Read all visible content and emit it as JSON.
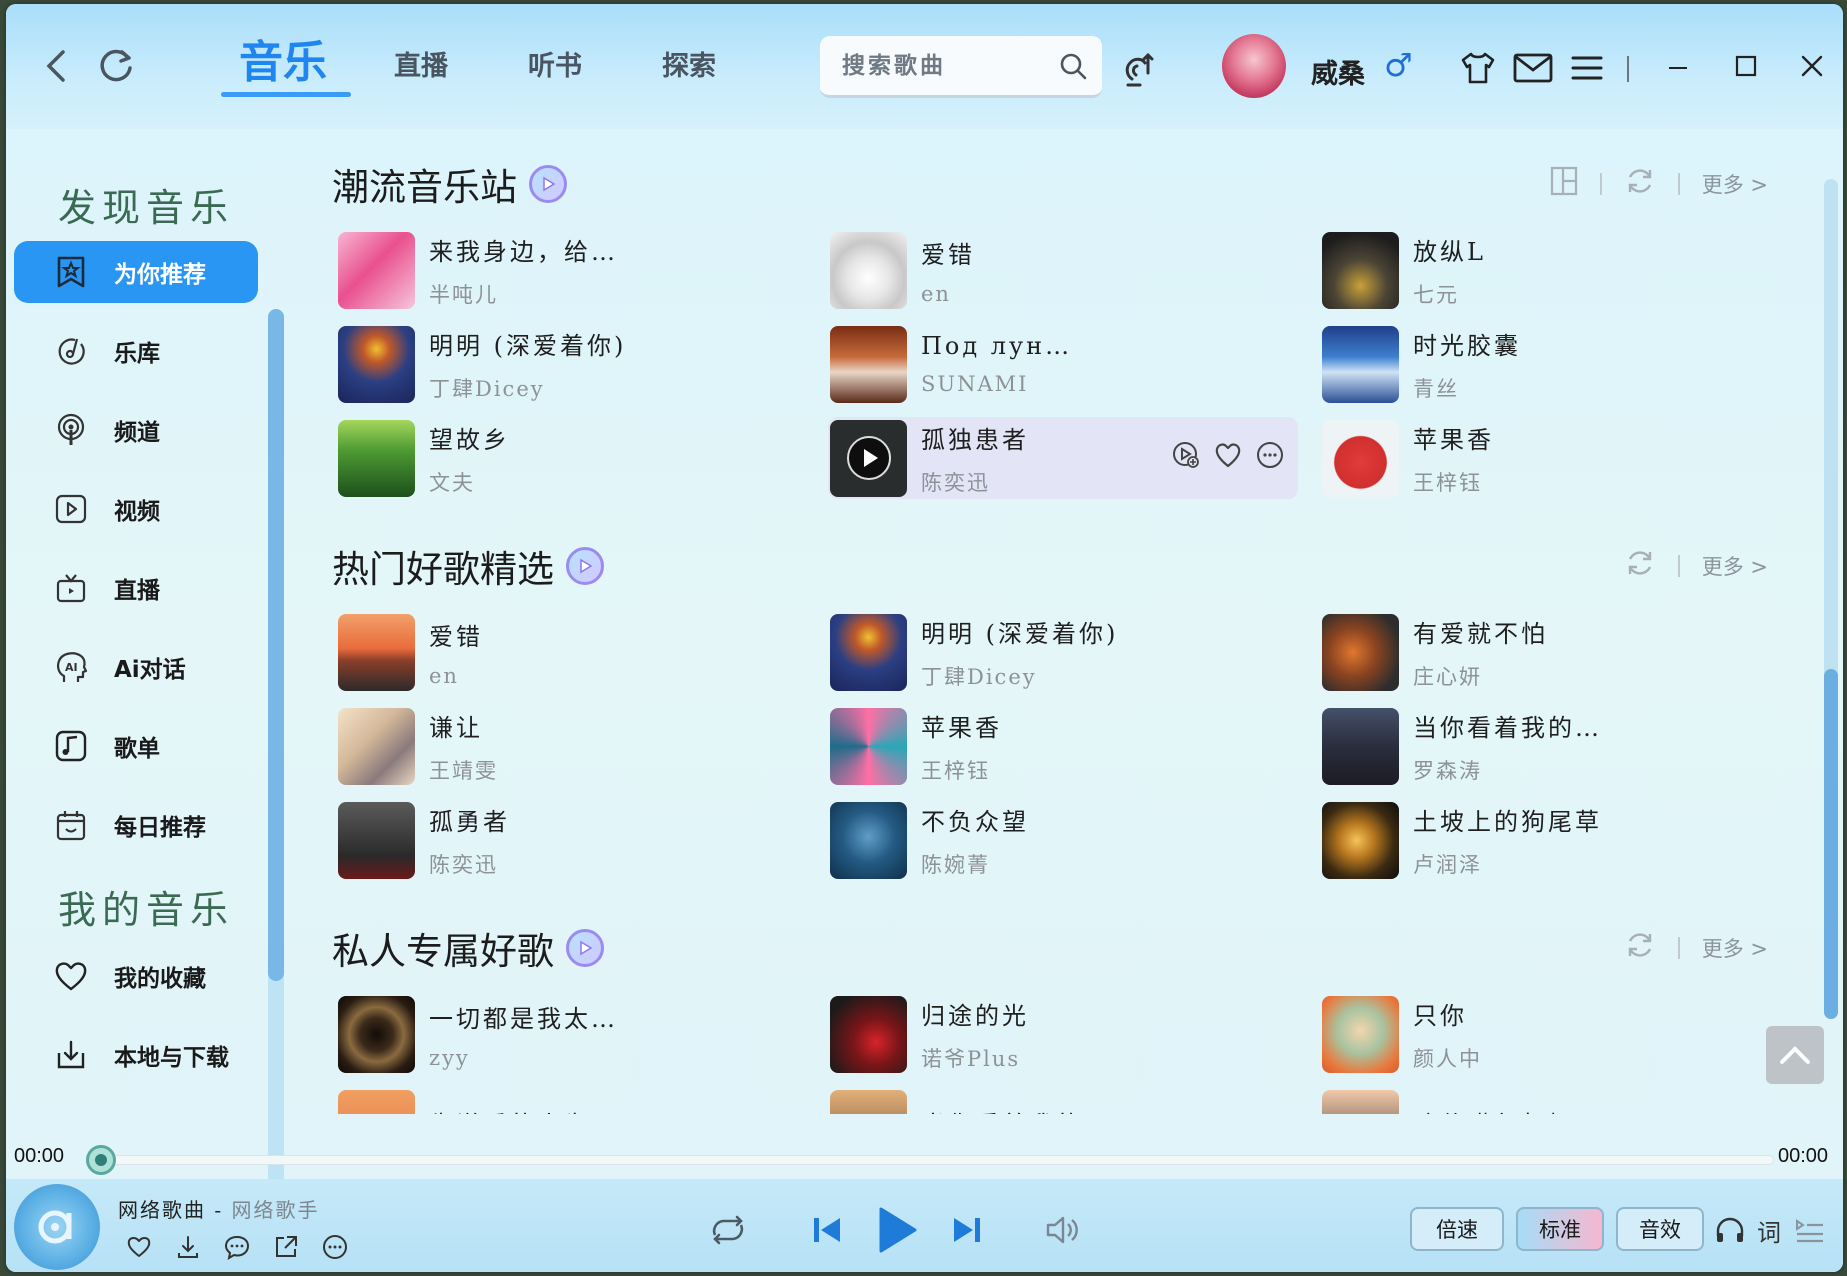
{
  "topbar": {
    "tabs": [
      {
        "label": "音乐",
        "active": true
      },
      {
        "label": "直播"
      },
      {
        "label": "听书"
      },
      {
        "label": "探索"
      }
    ],
    "search_placeholder": "搜索歌曲",
    "username": "威桑",
    "gender_symbol": "♂"
  },
  "sidebar": {
    "discover_heading": "发现音乐",
    "my_heading": "我的音乐",
    "discover_items": [
      {
        "label": "为你推荐",
        "icon": "star-bookmark-icon",
        "active": true
      },
      {
        "label": "乐库",
        "icon": "music-disc-icon"
      },
      {
        "label": "频道",
        "icon": "podcast-icon"
      },
      {
        "label": "视频",
        "icon": "video-play-icon"
      },
      {
        "label": "直播",
        "icon": "tv-icon"
      },
      {
        "label": "Ai对话",
        "icon": "ai-head-icon"
      },
      {
        "label": "歌单",
        "icon": "music-note-icon"
      },
      {
        "label": "每日推荐",
        "icon": "calendar-icon"
      }
    ],
    "my_items": [
      {
        "label": "我的收藏",
        "icon": "heart-icon"
      },
      {
        "label": "本地与下载",
        "icon": "download-icon"
      }
    ]
  },
  "sections": [
    {
      "title": "潮流音乐站",
      "more_label": "更多 >",
      "songs": [
        {
          "title": "来我身边，给…",
          "artist": "半吨儿"
        },
        {
          "title": "爱错",
          "artist": "en"
        },
        {
          "title": "放纵L",
          "artist": "七元"
        },
        {
          "title": "明明 (深爱着你)",
          "artist": "丁肆Dicey"
        },
        {
          "title": "Под лун…",
          "artist": "SUNAMI"
        },
        {
          "title": "时光胶囊",
          "artist": "青丝"
        },
        {
          "title": "望故乡",
          "artist": "文夫"
        },
        {
          "title": "孤独患者",
          "artist": "陈奕迅",
          "hover": true
        },
        {
          "title": "苹果香",
          "artist": "王梓钰"
        }
      ]
    },
    {
      "title": "热门好歌精选",
      "more_label": "更多 >",
      "songs": [
        {
          "title": "爱错",
          "artist": "en"
        },
        {
          "title": "明明 (深爱着你)",
          "artist": "丁肆Dicey"
        },
        {
          "title": "有爱就不怕",
          "artist": "庄心妍"
        },
        {
          "title": "谦让",
          "artist": "王靖雯"
        },
        {
          "title": "苹果香",
          "artist": "王梓钰"
        },
        {
          "title": "当你看着我的…",
          "artist": "罗森涛"
        },
        {
          "title": "孤勇者",
          "artist": "陈奕迅"
        },
        {
          "title": "不负众望",
          "artist": "陈婉菁"
        },
        {
          "title": "土坡上的狗尾草",
          "artist": "卢润泽"
        }
      ]
    },
    {
      "title": "私人专属好歌",
      "more_label": "更多 >",
      "songs": [
        {
          "title": "一切都是我太…",
          "artist": "zyy"
        },
        {
          "title": "归途的光",
          "artist": "诺爷Plus"
        },
        {
          "title": "只你",
          "artist": "颜人中"
        },
        {
          "title": "先说爱的人为…",
          "artist": ""
        },
        {
          "title": "当你看着我的…",
          "artist": ""
        },
        {
          "title": "喀什噶尔胡杨",
          "artist": ""
        }
      ]
    }
  ],
  "player": {
    "elapsed": "00:00",
    "duration": "00:00",
    "progress": 0,
    "track_title": "网络歌曲",
    "track_sep": " - ",
    "track_artist": "网络歌手",
    "speed_label": "倍速",
    "quality_label": "标准",
    "effect_label": "音效",
    "lyrics_label": "词"
  },
  "colors": {
    "accent": "#2a96f3",
    "active_tab": "#1f86f0",
    "sidebar_heading": "#3b6a54"
  }
}
